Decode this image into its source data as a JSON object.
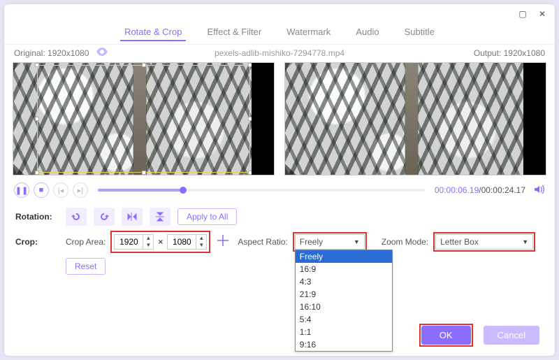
{
  "window": {
    "maximize_glyph": "▢",
    "close_glyph": "✕"
  },
  "tabs": {
    "rotate_crop": "Rotate & Crop",
    "effect_filter": "Effect & Filter",
    "watermark": "Watermark",
    "audio": "Audio",
    "subtitle": "Subtitle"
  },
  "meta": {
    "original_label": "Original:  1920x1080",
    "filename": "pexels-adlib-mishiko-7294778.mp4",
    "output_label": "Output:  1920x1080"
  },
  "transport": {
    "current": "00:00:06.19",
    "sep": "/",
    "total": "00:00:24.17"
  },
  "rotation": {
    "label": "Rotation:",
    "apply_all": "Apply to All"
  },
  "crop": {
    "label": "Crop:",
    "area_label": "Crop Area:",
    "w": "1920",
    "h": "1080",
    "times": "×",
    "reset": "Reset",
    "aspect_label": "Aspect Ratio:",
    "aspect_value": "Freely",
    "aspect_options": [
      "Freely",
      "16:9",
      "4:3",
      "21:9",
      "16:10",
      "5:4",
      "1:1",
      "9:16"
    ],
    "zoom_label": "Zoom Mode:",
    "zoom_value": "Letter Box"
  },
  "footer": {
    "ok": "OK",
    "cancel": "Cancel"
  }
}
